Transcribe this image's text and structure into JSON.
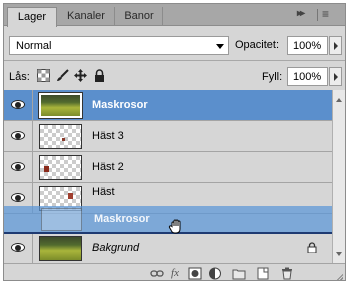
{
  "tabs": [
    {
      "label": "Lager",
      "active": true
    },
    {
      "label": "Kanaler",
      "active": false
    },
    {
      "label": "Banor",
      "active": false
    }
  ],
  "blend": {
    "mode": "Normal",
    "opacity_label": "Opacitet:",
    "opacity_value": "100%"
  },
  "lock": {
    "label": "Lås:",
    "fill_label": "Fyll:",
    "fill_value": "100%"
  },
  "layers": [
    {
      "name": "Maskrosor",
      "selected": true,
      "visible": true,
      "thumb": "photo"
    },
    {
      "name": "Häst 3",
      "selected": false,
      "visible": true,
      "thumb": "transparent"
    },
    {
      "name": "Häst 2",
      "selected": false,
      "visible": true,
      "thumb": "transparent"
    },
    {
      "name": "Häst",
      "selected": false,
      "visible": true,
      "thumb": "transparent"
    },
    {
      "name": "Bakgrund",
      "selected": false,
      "visible": true,
      "thumb": "photo",
      "locked": true
    }
  ],
  "drag_ghost_label": "Maskrosor",
  "colors": {
    "selection": "#5b8fcc",
    "panel": "#d6d6d6",
    "tabbar": "#a7a7a7"
  }
}
